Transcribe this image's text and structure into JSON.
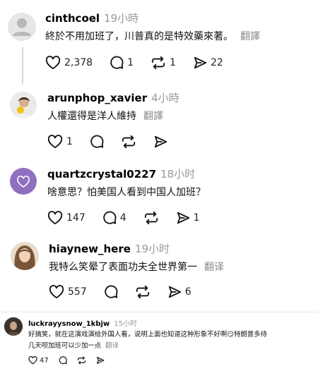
{
  "posts": [
    {
      "username": "cinthcoel",
      "time": "19小時",
      "text": "終於不用加班了，川普真的是特效藥來著。",
      "translate": "翻譯",
      "likes": "2,378",
      "comments": "1",
      "reposts": "1",
      "shares": "22"
    },
    {
      "username": "arunphop_xavier",
      "time": "4小時",
      "text": "人權還得是洋人維持",
      "translate": "翻譯",
      "likes": "1"
    },
    {
      "username": "quartzcrystal0227",
      "time": "18小时",
      "text": "啥意思？怕美国人看到中国人加班？",
      "likes": "147",
      "comments": "4",
      "shares": "1"
    },
    {
      "username": "hiaynew_here",
      "time": "19小时",
      "text": "我特么笑晕了表面功夫全世界第一",
      "translate": "翻译",
      "likes": "557",
      "shares": "6"
    },
    {
      "username": "luckrayysnow_1kbjw",
      "time": "15小时",
      "text_line1": "好搞笑，就在这演戏演给外国人看，说明上面也知道这种形象不好啊😏特朗普多待",
      "text_line2": "几天呗加班可以少加一点",
      "translate": "翻译",
      "likes": "47"
    }
  ],
  "colors": {
    "icon": "#111111",
    "muted": "#999999",
    "line": "#d9d9d9",
    "avatar_purple": "#8e6fc0"
  },
  "icons": [
    "heart-icon",
    "comment-icon",
    "repost-icon",
    "share-icon"
  ]
}
